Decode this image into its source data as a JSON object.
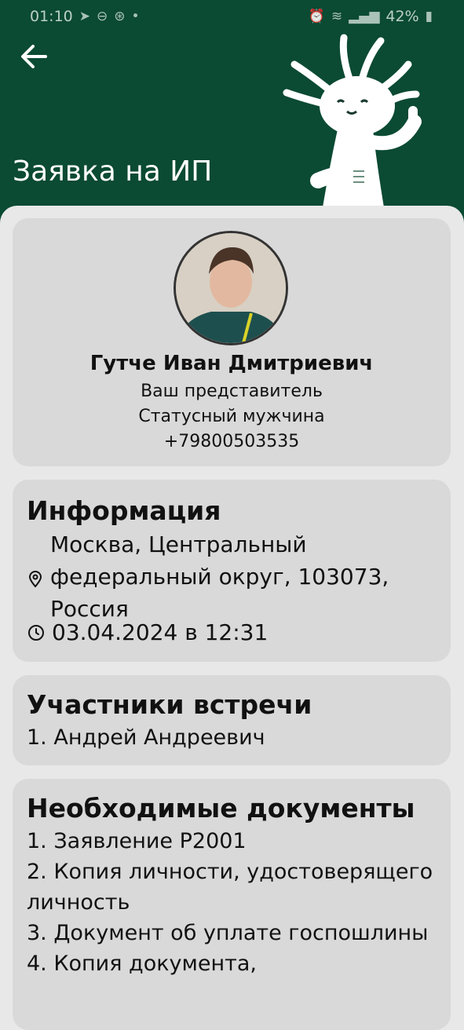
{
  "status_bar": {
    "time": "01:10",
    "battery": "42%",
    "left_icons": [
      "telegram-icon",
      "minus-circle-icon",
      "shazam-icon",
      "dot-icon"
    ],
    "right_icons": [
      "alarm-icon",
      "wifi-icon",
      "signal-icon",
      "battery-icon"
    ]
  },
  "header": {
    "title": "Заявка на ИП",
    "background_color": "#0b4a33"
  },
  "representative": {
    "name": "Гутче Иван Дмитриевич",
    "role": "Ваш представитель",
    "status": "Статусный мужчина",
    "phone": "+79800503535"
  },
  "info": {
    "heading": "Информация",
    "address": "Москва, Центральный федеральный округ, 103073, Россия",
    "datetime": "03.04.2024 в 12:31"
  },
  "participants": {
    "heading": "Участники встречи",
    "items": [
      "1. Андрей Андреевич"
    ]
  },
  "documents": {
    "heading": "Необходимые документы",
    "items": [
      "1. Заявление Р2001",
      "2. Копия личности, удостоверящего личность",
      "3. Документ об уплате госпошлины",
      "4. Копия документа,"
    ]
  }
}
